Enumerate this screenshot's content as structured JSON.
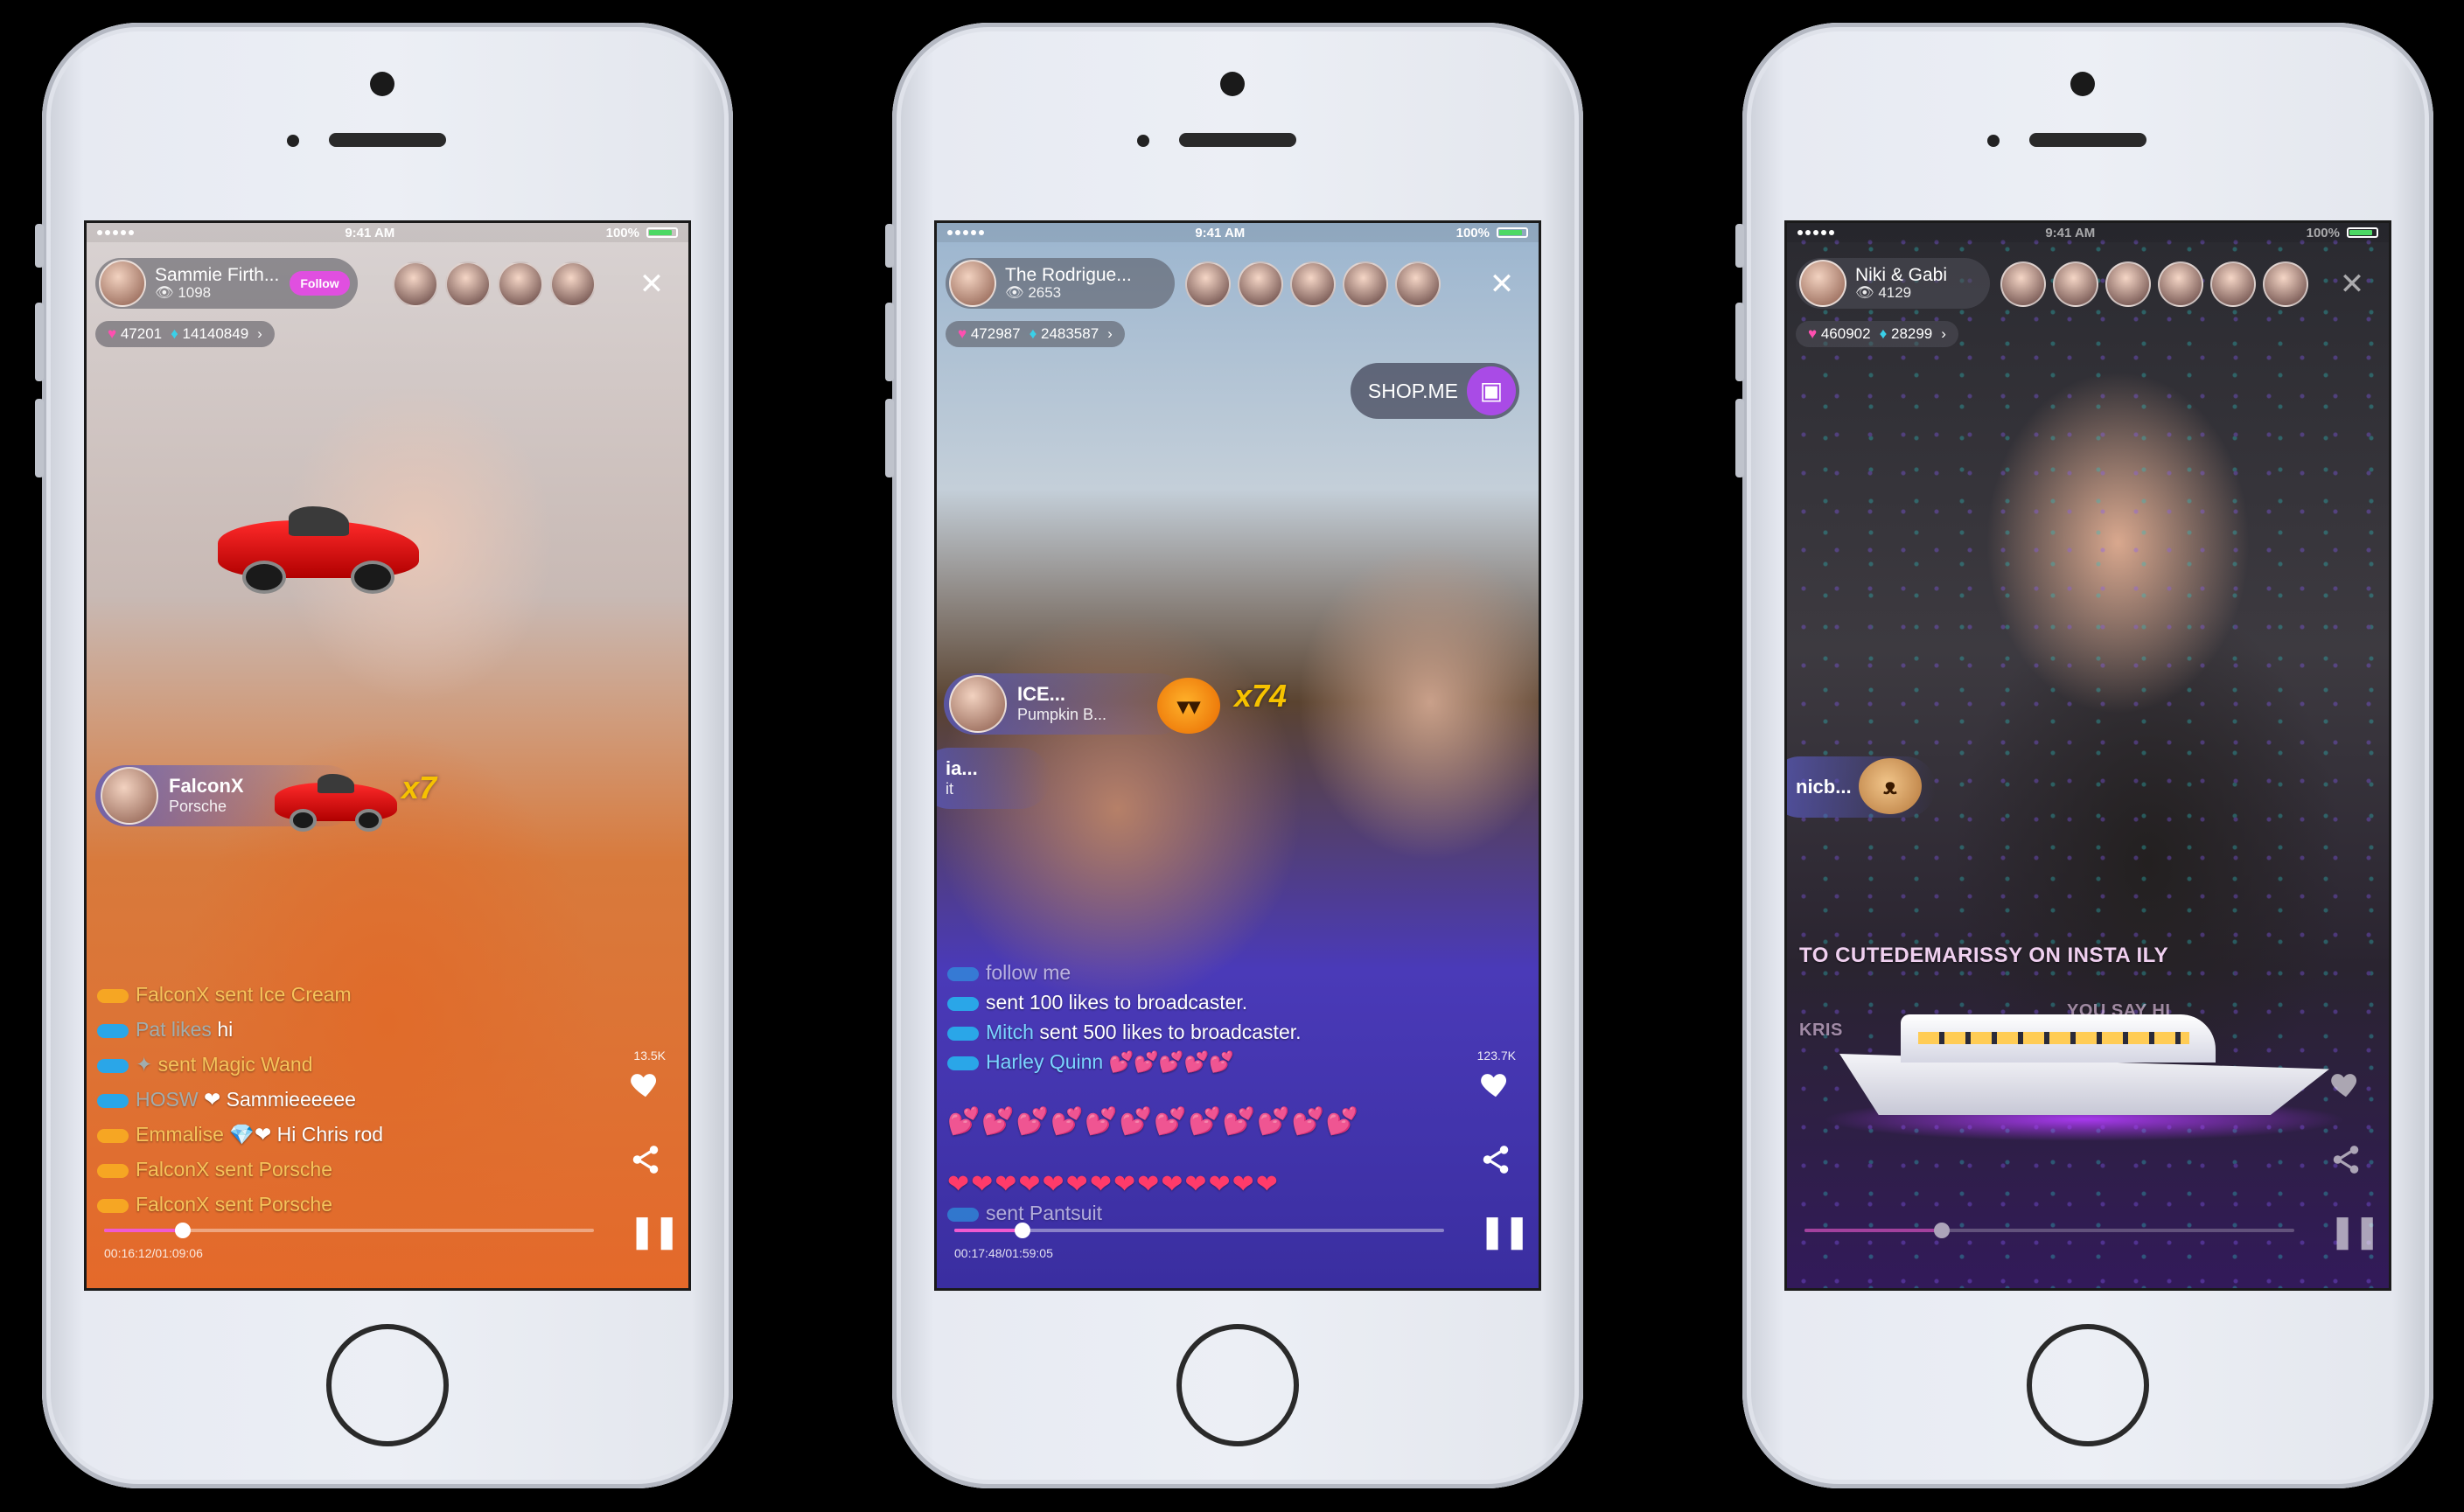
{
  "phones": [
    {
      "status": {
        "time": "9:41 AM",
        "battery": "100%"
      },
      "host": {
        "name": "Sammie Firth...",
        "viewers": "1098",
        "follow_label": "Follow"
      },
      "stats": {
        "hearts": "47201",
        "diamonds": "14140849"
      },
      "gift": {
        "sender": "FalconX",
        "item": "Porsche",
        "count": "x7"
      },
      "chat": [
        {
          "name": "FalconX",
          "text": "sent Ice Cream"
        },
        {
          "name": "",
          "text": "hi"
        },
        {
          "name": "",
          "text": "sent Magic Wand"
        },
        {
          "name": "",
          "text": "Sammieeeeee"
        },
        {
          "name": "Emmalise",
          "text": "Hi Chris rod"
        },
        {
          "name": "FalconX",
          "text": "sent Porsche"
        },
        {
          "name": "FalconX",
          "text": "sent Porsche"
        }
      ],
      "likes": "13.5K",
      "progress": {
        "time": "00:16:12/01:09:06",
        "fraction": 0.16
      }
    },
    {
      "status": {
        "time": "9:41 AM",
        "battery": "100%"
      },
      "host": {
        "name": "The Rodrigue...",
        "viewers": "2653"
      },
      "stats": {
        "hearts": "472987",
        "diamonds": "2483587"
      },
      "shop_label": "SHOP.ME",
      "gift": {
        "sender": "ICE...",
        "item": "Pumpkin B...",
        "count": "x74"
      },
      "gift2": {
        "sender": "ia...",
        "item": "it"
      },
      "chat": [
        {
          "name": "",
          "text": "follow me"
        },
        {
          "name": "",
          "text": "sent 100 likes to broadcaster."
        },
        {
          "name": "Mitch",
          "text": "sent 500 likes to broadcaster."
        },
        {
          "name": "Harley Quinn",
          "text": ""
        }
      ],
      "last_line": "sent Pantsuit",
      "likes": "123.7K",
      "progress": {
        "time": "00:17:48/01:59:05",
        "fraction": 0.14
      }
    },
    {
      "status": {
        "time": "9:41 AM",
        "battery": "100%"
      },
      "host": {
        "name": "Niki & Gabi",
        "viewers": "4129"
      },
      "stats": {
        "hearts": "460902",
        "diamonds": "28299"
      },
      "gift": {
        "sender": "nicb..."
      },
      "caption": "TO CUTEDEMARISSY ON INSTA ILY",
      "caption2": "YOU SAY HI",
      "caption3": "KRIS",
      "progress": {
        "fraction": 0.28
      }
    }
  ],
  "icons": {
    "close": "✕",
    "heart": "heart-icon",
    "share": "share-icon",
    "pause": "pause-icon"
  },
  "colors": {
    "accent": "#e04fe0",
    "progress": "#f05ad0",
    "shop": "#a94be6"
  }
}
